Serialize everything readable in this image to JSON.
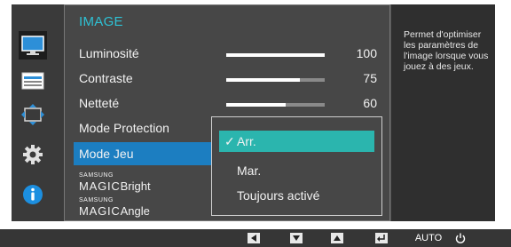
{
  "menu": {
    "title": "IMAGE",
    "rows": [
      {
        "label": "Luminosité",
        "value": "100",
        "level": 1.0
      },
      {
        "label": "Contraste",
        "value": "75",
        "level": 0.75
      },
      {
        "label": "Netteté",
        "value": "60",
        "level": 0.6
      },
      {
        "label": "Mode Protection"
      },
      {
        "label": "Mode Jeu"
      }
    ],
    "magic_bright": {
      "brand_small": "SAMSUNG",
      "brand_big": "MAGIC",
      "rest": "Bright"
    },
    "magic_angle": {
      "brand_small": "SAMSUNG",
      "brand_big": "MAGIC",
      "rest": "Angle"
    }
  },
  "dropdown": {
    "options": [
      {
        "label": "Arr.",
        "selected": true
      },
      {
        "label": "Mar.",
        "selected": false
      },
      {
        "label": "Toujours activé",
        "selected": false
      }
    ]
  },
  "help": {
    "text": "Permet d'optimiser les paramètres de l'image lorsque vous jouez à des jeux."
  },
  "sidebar": {
    "icons": [
      "monitor-icon",
      "picture-size-icon",
      "position-arrows-icon",
      "gear-icon",
      "info-icon"
    ]
  },
  "bottom_bar": {
    "buttons": [
      {
        "icon": "left-arrow-icon"
      },
      {
        "icon": "down-arrow-icon"
      },
      {
        "icon": "up-arrow-icon"
      },
      {
        "icon": "enter-icon"
      },
      {
        "label": "AUTO"
      },
      {
        "icon": "power-icon"
      }
    ]
  },
  "colors": {
    "accent_title": "#2ec1d4",
    "highlight": "#1c7ec1",
    "selected_option": "#2bb5ae"
  }
}
